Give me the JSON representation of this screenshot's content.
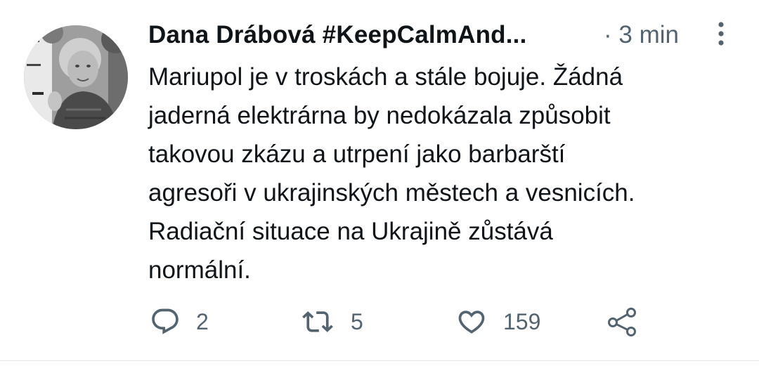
{
  "tweet": {
    "author_name": "Dana Drábová #KeepCalmAnd...",
    "timestamp": "· 3 min",
    "text": "Mariupol je v troskách a stále bojuje. Žádná\njaderná elektrárna by nedokázala způsobit\ntakovou zkázu a utrpení jako barbarští\nagresoři v ukrajinských městech a vesnicích.\nRadiační situace na Ukrajině zůstává\nnormální.",
    "avatar_icon": "avatar-photo",
    "more_icon": "more-vertical-icon"
  },
  "actions": {
    "reply": {
      "icon": "reply-icon",
      "count": "2"
    },
    "retweet": {
      "icon": "retweet-icon",
      "count": "5"
    },
    "like": {
      "icon": "heart-icon",
      "count": "159"
    },
    "share": {
      "icon": "share-icon"
    }
  },
  "colors": {
    "text_primary": "#0f1419",
    "text_secondary": "#536471",
    "divider": "#e6e9eb"
  }
}
